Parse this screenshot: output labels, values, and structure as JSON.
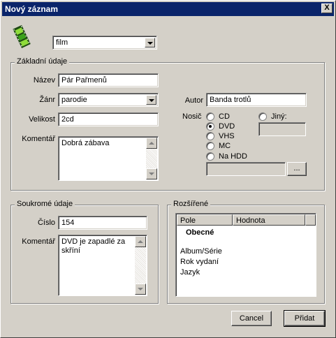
{
  "window": {
    "title": "Nový záznam",
    "close_glyph": "X"
  },
  "type_combo": {
    "value": "film"
  },
  "basic": {
    "group_title": "Základní údaje",
    "name_label": "Název",
    "name_value": "Pár Pařmenů",
    "genre_label": "Žánr",
    "genre_value": "parodie",
    "size_label": "Velikost",
    "size_value": "2cd",
    "comment_label": "Komentář",
    "comment_value": "Dobrá zábava",
    "author_label": "Autor",
    "author_value": "Banda trotlů",
    "carrier_label": "Nosič",
    "carriers": [
      {
        "label": "CD",
        "checked": false
      },
      {
        "label": "DVD",
        "checked": true
      },
      {
        "label": "VHS",
        "checked": false
      },
      {
        "label": "MC",
        "checked": false
      },
      {
        "label": "Na HDD",
        "checked": false
      }
    ],
    "other_label": "Jiný:",
    "other_value": "",
    "path_value": "",
    "browse_label": "..."
  },
  "private": {
    "group_title": "Soukromé údaje",
    "number_label": "Číslo",
    "number_value": "154",
    "comment_label": "Komentář",
    "comment_value": "DVD je zapadlé za skříní"
  },
  "extended": {
    "group_title": "Rozšířené",
    "columns": [
      "Pole",
      "Hodnota"
    ],
    "section": "Obecné",
    "rows": [
      "Album/Série",
      "Rok vydaní",
      "Jazyk"
    ]
  },
  "buttons": {
    "cancel": "Cancel",
    "add": "Přidat"
  },
  "colors": {
    "face": "#d4d0c8",
    "titlebar": "#0a246a",
    "icon_green": "#3aa21a",
    "icon_dark": "#1e4a12"
  },
  "icons": {
    "app": "film-strip-icon"
  }
}
